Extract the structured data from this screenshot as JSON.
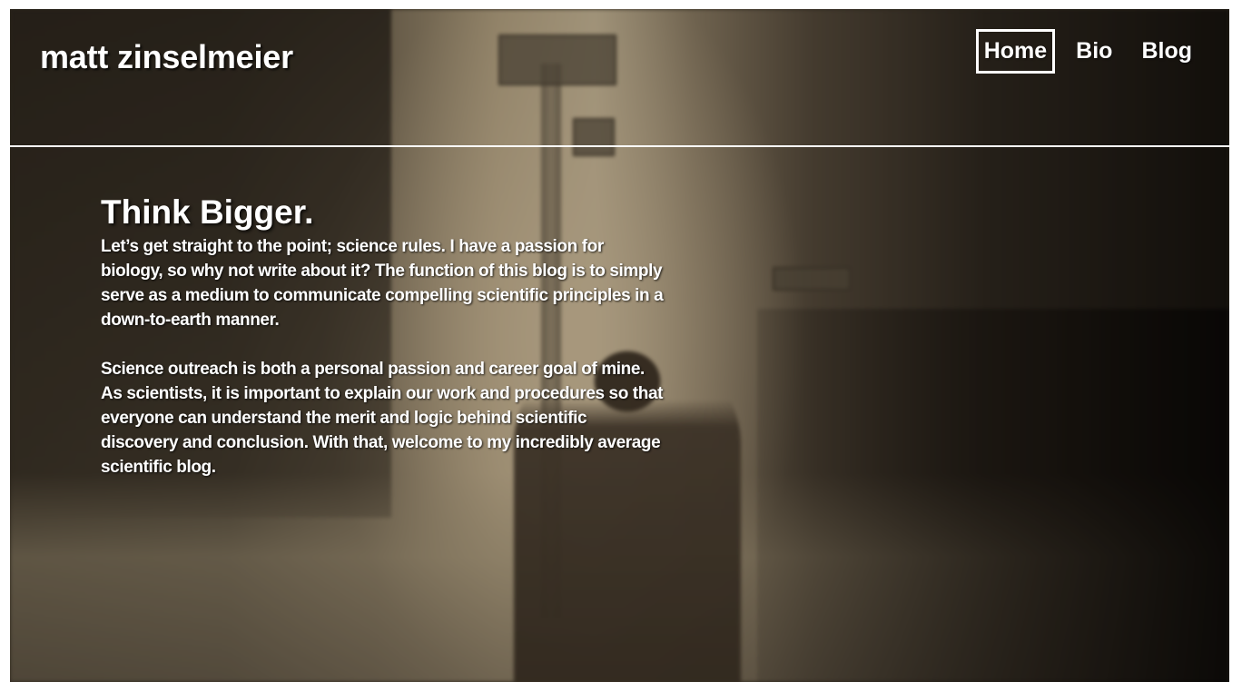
{
  "site": {
    "title": "matt zinselmeier"
  },
  "nav": {
    "items": [
      {
        "label": "Home",
        "active": true
      },
      {
        "label": "Bio",
        "active": false
      },
      {
        "label": "Blog",
        "active": false
      }
    ]
  },
  "main": {
    "heading": "Think Bigger.",
    "paragraphs": [
      "Let’s get straight to the point; science rules. I have a passion for biology, so why not write about it? The function of this blog is to simply serve as a medium to communicate compelling scientific principles in a down-to-earth manner.",
      "Science outreach is both a personal passion and career goal of mine. As scientists, it is important to explain our work and procedures so that everyone can understand the merit and logic behind scientific discovery and conclusion. With that, welcome to my incredibly average scientific blog."
    ]
  },
  "colors": {
    "text": "#ffffff",
    "background_tone": "#2a241c",
    "nav_active_border": "#ffffff"
  },
  "background": {
    "image": "sepia-toned-city-street-with-pedestrians"
  }
}
